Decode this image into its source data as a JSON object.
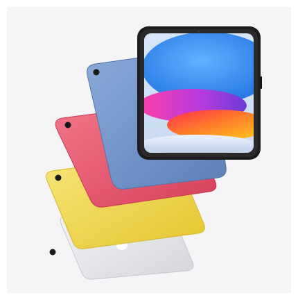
{
  "image": {
    "subject": "ipad-fan",
    "background_color": "#f5f5f7",
    "tablets": [
      {
        "name": "silver-ipad",
        "color": "#e8e9ec"
      },
      {
        "name": "yellow-ipad",
        "color": "#f2d94a"
      },
      {
        "name": "pink-ipad",
        "color": "#e8566a"
      },
      {
        "name": "blue-ipad",
        "color": "#6f93c9"
      },
      {
        "name": "front-ipad-screen",
        "color": "#1c1c1e"
      }
    ]
  }
}
